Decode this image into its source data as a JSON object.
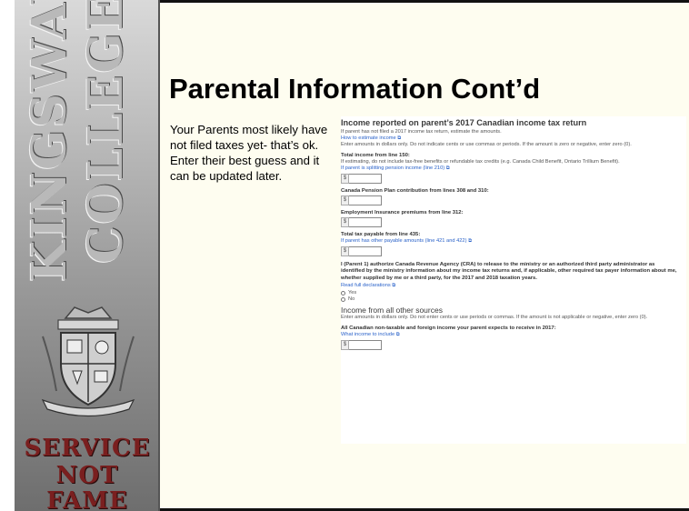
{
  "sidebar": {
    "word1": "KINGSWAY",
    "word2": "COLLEGE",
    "motto": [
      "SERVICE",
      "NOT",
      "FAME"
    ]
  },
  "slide": {
    "title": "Parental Information  Cont’d",
    "notes": "Your Parents most likely have not filed taxes yet- that’s ok.  Enter their best guess and it can be updated later."
  },
  "form": {
    "heading": "Income reported on parent’s 2017 Canadian income tax return",
    "intro1": "If parent has not filed a 2017 income tax return, estimate the amounts.",
    "estimate_link": "How to estimate income",
    "intro2": "Enter amounts in dollars only. Do not indicate cents or use commas or periods. If the amount is zero or negative, enter zero (0).",
    "currency": "$",
    "fields": [
      {
        "label": "Total income from line 150:",
        "help": "If estimating, do not include tax-free benefits or refundable tax credits (e.g. Canada Child Benefit, Ontario Trillium Benefit).",
        "link": "If parent is splitting pension income (line 210)"
      },
      {
        "label": "Canada Pension Plan contribution from lines 308 and 310:"
      },
      {
        "label": "Employment Insurance premiums from line 312:"
      },
      {
        "label": "Total tax payable from line 435:",
        "link": "If parent has other payable amounts (line 421 and 422)"
      }
    ],
    "authorization": "I (Parent 1) authorize Canada Revenue Agency (CRA) to release to the ministry or an authorized third party administrator as identified by the ministry information about my income tax returns and, if applicable, other required tax payer information about me, whether supplied by me or a third party, for the 2017 and 2018 taxation years.",
    "declarations_link": "Read full declarations",
    "options": [
      "Yes",
      "No"
    ],
    "other_heading": "Income from all other sources",
    "other_intro": "Enter amounts in dollars only. Do not enter cents or use periods or commas. If the amount is not applicable or negative, enter zero (0).",
    "other_label": "All Canadian non-taxable and foreign income your parent expects to receive in 2017:",
    "other_link": "What income to include"
  }
}
